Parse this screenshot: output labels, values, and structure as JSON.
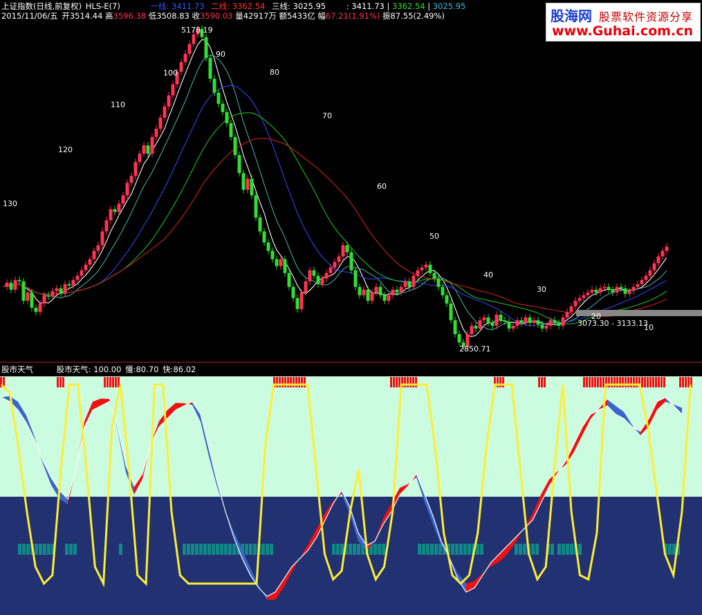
{
  "header": {
    "line1": {
      "index_name": "上证指数(日线,前复权)",
      "indicator": "HLS-E(7)",
      "line_a_label": "一线:",
      "line_a_value": "3411.73",
      "line_b_label": "二线:",
      "line_b_value": "3362.54",
      "line_c_label": "三线:",
      "line_c_value": "3025.95",
      "right_a": ": 3411.73",
      "right_b": "3362.54",
      "right_c": "3025.95"
    },
    "line2": {
      "date": "2015/11/06/五",
      "open_label": "开",
      "open": "3514.44",
      "high_label": "高",
      "high": "3596.38",
      "low_label": "低",
      "low": "3508.83",
      "close_label": "收",
      "close": "3590.03",
      "vol_label": "量",
      "vol": "42917万",
      "amt_label": "额",
      "amt": "5433亿",
      "chg_label": "幅",
      "chg": "67.21(1.91%)",
      "amp_label": "振",
      "amp": "87.55(2.49%)"
    }
  },
  "watermark": {
    "logo": "股海网",
    "slogan": "股票软件资源分享",
    "url": "www.Guhai.com.cn"
  },
  "indicator_header": {
    "name": "股市天气",
    "detail_name": "股市天气:",
    "value": "100.00",
    "slow_label": "慢:",
    "slow": "80.70",
    "fast_label": "快:",
    "fast": "86.02"
  },
  "colors": {
    "up": "#ff3355",
    "down": "#33dd33",
    "line_white": "#ffffff",
    "line_red": "#cc2222",
    "line_blue": "#3344ee",
    "line_green": "#22bb22",
    "line_cyan": "#44aaaa",
    "line_yellow": "#ffee33",
    "zone_light": "#ccfce0",
    "zone_dark": "#213171",
    "band_red": "#ee1111",
    "band_blue": "#3a66cc",
    "marker_teal": "#118888"
  },
  "chart_data": [
    {
      "type": "candlestick",
      "title": "上证指数(日线,前复权)",
      "x_index": [
        0,
        1,
        2,
        3,
        4,
        5,
        6,
        7,
        8,
        9,
        10,
        11,
        12,
        13,
        14,
        15,
        16,
        17,
        18,
        19,
        20,
        21,
        22,
        23,
        24,
        25,
        26,
        27,
        28,
        29,
        30,
        31,
        32,
        33,
        34,
        35,
        36,
        37,
        38,
        39,
        40,
        41,
        42,
        43,
        44,
        45,
        46,
        47,
        48,
        49,
        50,
        51,
        52,
        53,
        54,
        55,
        56,
        57,
        58,
        59,
        60,
        61,
        62,
        63,
        64,
        65,
        66,
        67,
        68,
        69,
        70,
        71,
        72,
        73,
        74,
        75,
        76,
        77,
        78,
        79,
        80,
        81,
        82,
        83,
        84,
        85,
        86,
        87,
        88,
        89,
        90,
        91,
        92,
        93,
        94,
        95,
        96,
        97,
        98,
        99,
        100,
        101,
        102,
        103,
        104,
        105,
        106,
        107,
        108,
        109,
        110,
        111,
        112,
        113,
        114,
        115,
        116,
        117,
        118,
        119,
        120,
        121,
        122,
        123,
        124,
        125,
        126,
        127,
        128,
        129,
        130,
        131,
        132,
        133,
        134,
        135,
        136,
        137,
        138,
        139,
        140,
        141,
        142,
        143,
        144,
        145,
        146,
        147,
        148,
        149,
        150,
        151,
        152,
        153,
        154,
        155,
        156,
        157,
        158,
        159,
        160,
        161,
        162,
        163,
        164,
        165,
        166
      ],
      "annotations": [
        {
          "label": "5178.19",
          "kind": "high"
        },
        {
          "label": "2850.71",
          "kind": "low"
        },
        {
          "label": "3073.30 - 3133.13",
          "kind": "range"
        }
      ],
      "line_labels": [
        "130",
        "120",
        "110",
        "100",
        "90",
        "80",
        "70",
        "60",
        "50",
        "40",
        "30",
        "20",
        "10"
      ],
      "ylim": [
        2780,
        5260
      ]
    },
    {
      "type": "area",
      "title": "股市天气",
      "series": [
        {
          "name": "股市天气",
          "value": 100.0
        },
        {
          "name": "慢",
          "value": 80.7
        },
        {
          "name": "快",
          "value": 86.02
        }
      ],
      "ylim": [
        0,
        100
      ]
    }
  ]
}
